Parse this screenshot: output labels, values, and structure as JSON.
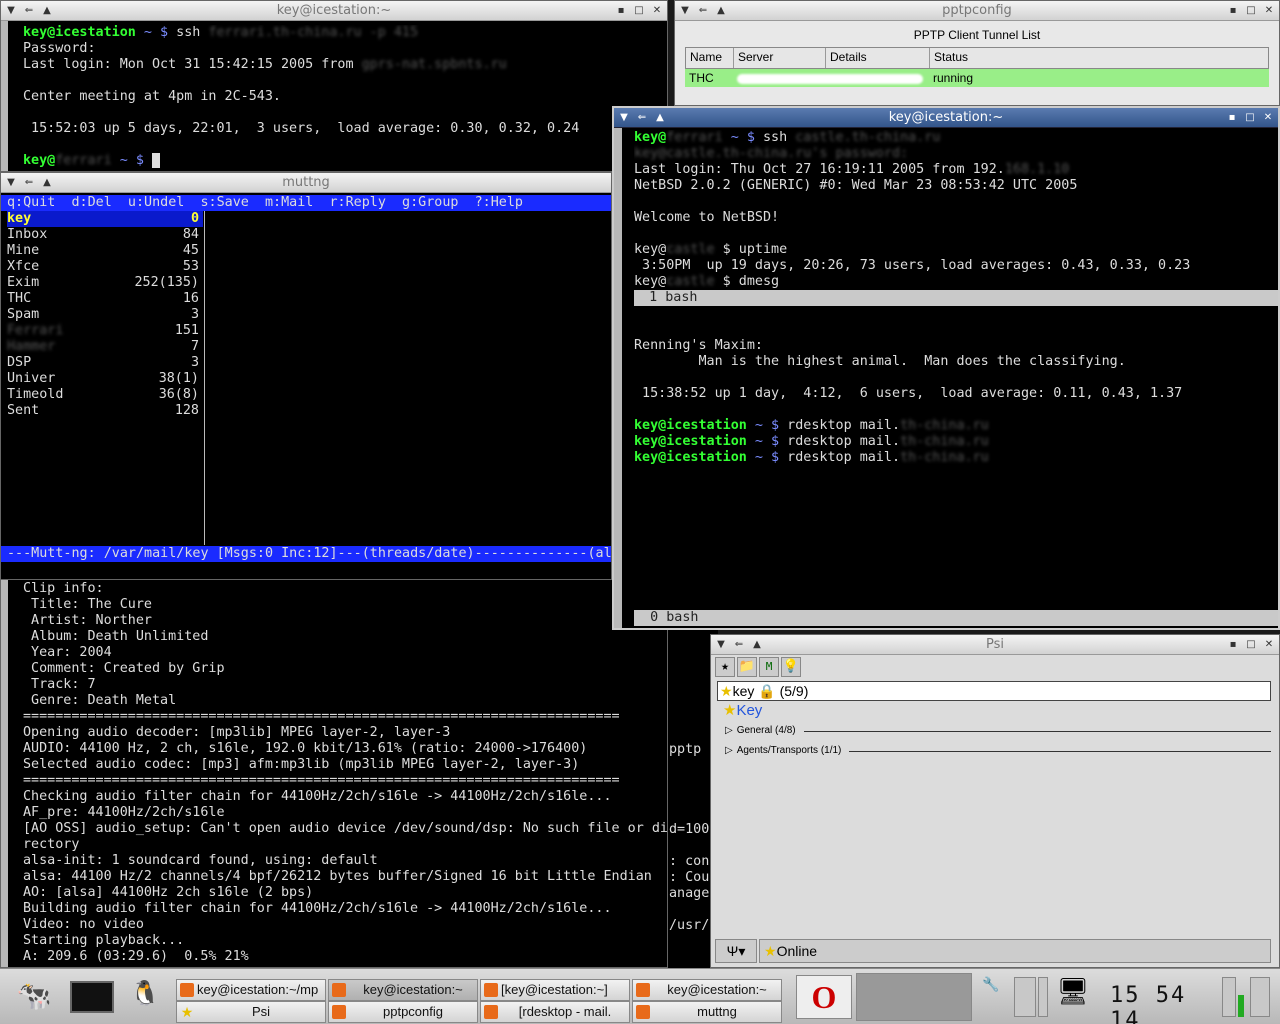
{
  "win1": {
    "title": "key@icestation:~",
    "lines": [
      {
        "p": "key@icestation",
        "rest": " ~ $ ssh ",
        "blur": "ferrari.th-china.ru -p 415"
      },
      {
        "t": "Password:"
      },
      {
        "t": "Last login: Mon Oct 31 15:42:15 2005 from ",
        "blur": "gprs-nat.spbnts.ru"
      },
      {
        "t": ""
      },
      {
        "t": "Center meeting at 4pm in 2C-543."
      },
      {
        "t": ""
      },
      {
        "t": " 15:52:03 up 5 days, 22:01,  3 users,  load average: 0.30, 0.32, 0.24"
      },
      {
        "t": ""
      },
      {
        "p": "key@",
        "blur": "ferrari",
        "rest2": " ~ $ "
      }
    ]
  },
  "mutt": {
    "title": "muttng",
    "help": "q:Quit  d:Del  u:Undel  s:Save  m:Mail  r:Reply  g:Group  ?:Help",
    "folders": [
      {
        "n": "key",
        "c": "0"
      },
      {
        "n": "Inbox",
        "c": "84"
      },
      {
        "n": "Mine",
        "c": "45"
      },
      {
        "n": "Xfce",
        "c": "53"
      },
      {
        "n": "Exim",
        "c": "252(135)"
      },
      {
        "n": "THC",
        "c": "16"
      },
      {
        "n": "Spam",
        "c": "3"
      },
      {
        "n": "Ferrari",
        "c": "151"
      },
      {
        "n": "Hammer",
        "c": "7"
      },
      {
        "n": "DSP",
        "c": "3"
      },
      {
        "n": "Univer",
        "c": "38(1)"
      },
      {
        "n": "Timeold",
        "c": "36(8)"
      },
      {
        "n": "Sent",
        "c": "128"
      }
    ],
    "status": "---Mutt-ng: /var/mail/key [Msgs:0 Inc:12]---(threads/date)--------------(al"
  },
  "mplayer": {
    "lines": [
      "Clip info:",
      " Title: The Cure",
      " Artist: Norther",
      " Album: Death Unlimited",
      " Year: 2004",
      " Comment: Created by Grip",
      " Track: 7",
      " Genre: Death Metal",
      "==========================================================================",
      "Opening audio decoder: [mp3lib] MPEG layer-2, layer-3",
      "AUDIO: 44100 Hz, 2 ch, s16le, 192.0 kbit/13.61% (ratio: 24000->176400)",
      "Selected audio codec: [mp3] afm:mp3lib (mp3lib MPEG layer-2, layer-3)",
      "==========================================================================",
      "Checking audio filter chain for 44100Hz/2ch/s16le -> 44100Hz/2ch/s16le...",
      "AF_pre: 44100Hz/2ch/s16le",
      "[AO OSS] audio_setup: Can't open audio device /dev/sound/dsp: No such file or di",
      "rectory",
      "alsa-init: 1 soundcard found, using: default",
      "alsa: 44100 Hz/2 channels/4 bpf/26212 bytes buffer/Signed 16 bit Little Endian",
      "AO: [alsa] 44100Hz 2ch s16le (2 bps)",
      "Building audio filter chain for 44100Hz/2ch/s16le -> 44100Hz/2ch/s16le...",
      "Video: no video",
      "Starting playback...",
      "A: 209.6 (03:29.6)  0.5% 21%"
    ]
  },
  "bg": {
    "lines": [
      "pptp",
      "",
      "",
      "",
      "",
      "d=100",
      "",
      ": con",
      ": Cou",
      "anage",
      "",
      "/usr/"
    ]
  },
  "pptp": {
    "title": "pptpconfig",
    "heading": "PPTP Client Tunnel List",
    "cols": [
      "Name",
      "Server",
      "Details",
      "Status"
    ],
    "row": {
      "name": "THC",
      "status": "running"
    }
  },
  "win2": {
    "title": "key@icestation:~",
    "top": [
      {
        "p": "key@",
        "blur": "ferrari",
        "rest2": " ~ $ ssh ",
        "blur2": "castle.th-china.ru"
      },
      {
        "blurline": "key@castle.th-china.ru's password:"
      },
      {
        "t": "Last login: Thu Oct 27 16:19:11 2005 from 192.",
        "blur": "168.1.10"
      },
      {
        "t": "NetBSD 2.0.2 (GENERIC) #0: Wed Mar 23 08:53:42 UTC 2005"
      },
      {
        "t": ""
      },
      {
        "t": "Welcome to NetBSD!"
      },
      {
        "t": ""
      },
      {
        "t": "key@",
        "blur": "castle",
        "t2": " $ uptime"
      },
      {
        "t": " 3:50PM  up 19 days, 20:26, 73 users, load averages: 0.43, 0.33, 0.23"
      },
      {
        "t": "key@",
        "blur": "castle",
        "t2": " $ dmesg"
      }
    ],
    "screen1": "  1 bash",
    "mid": [
      "",
      "",
      "Renning's Maxim:",
      "        Man is the highest animal.  Man does the classifying.",
      "",
      " 15:38:52 up 1 day,  4:12,  6 users,  load average: 0.11, 0.43, 1.37",
      ""
    ],
    "rdp": [
      {
        "p": "key@icestation",
        "r": " ~ $ rdesktop mail.",
        "b": "th-china.ru"
      },
      {
        "p": "key@icestation",
        "r": " ~ $ rdesktop mail.",
        "b": "th-china.ru"
      },
      {
        "p": "key@icestation",
        "r": " ~ $ rdesktop mail.",
        "b": "th-china.ru"
      }
    ],
    "screen0": "  0 bash"
  },
  "psi": {
    "title": "Psi",
    "account": "key",
    "account_count": "(5/9)",
    "contact": "Key",
    "groups": [
      "General  (4/8)",
      "Agents/Transports  (1/1)"
    ],
    "status": "Online"
  },
  "taskbar": {
    "tasks": [
      "key@icestation:~/mp",
      "Psi",
      "key@icestation:~",
      "pptpconfig",
      "[key@icestation:~]",
      "[rdesktop - mail.",
      "key@icestation:~",
      "muttng"
    ],
    "clock": "15 54 14"
  },
  "colors": {
    "prompt": "#33ff33",
    "mutt_bar": "#1a2bff",
    "pptp_row": "#99ee88",
    "titlebar_active": "#4a6aa0"
  }
}
